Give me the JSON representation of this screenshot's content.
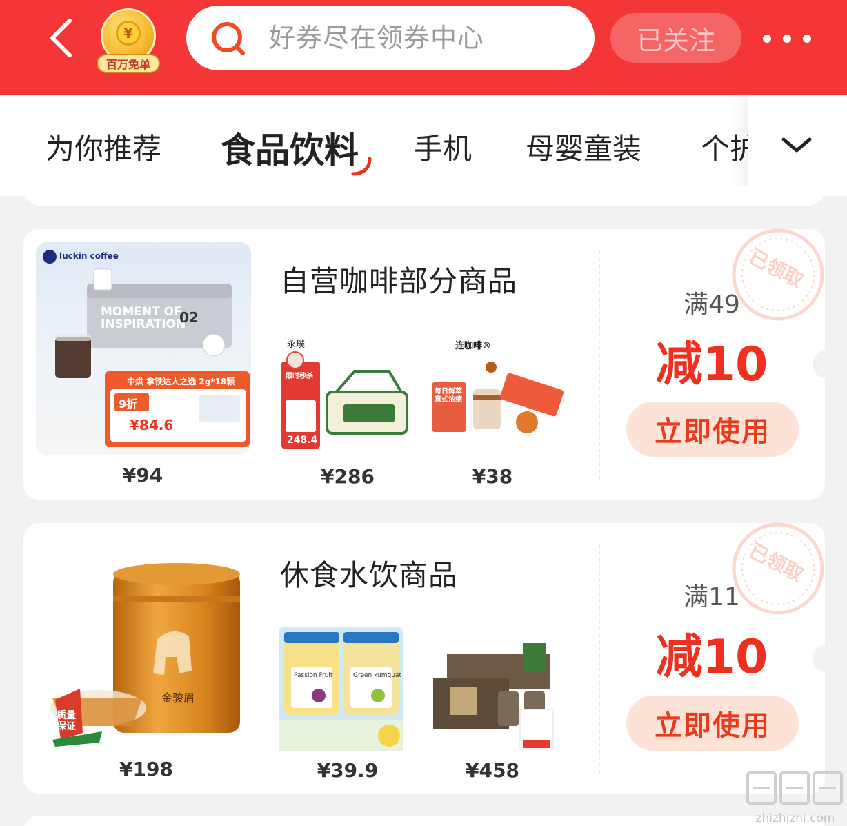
{
  "header": {
    "badge_label": "百万免单",
    "badge_coin_symbol": "¥",
    "search_placeholder": "好券尽在领券中心",
    "follow_label": "已关注"
  },
  "tabs": [
    {
      "label": "为你推荐",
      "active": false
    },
    {
      "label": "食品饮料",
      "active": true
    },
    {
      "label": "手机",
      "active": false
    },
    {
      "label": "母婴童装",
      "active": false
    },
    {
      "label": "个护",
      "active": false
    }
  ],
  "coupons": [
    {
      "title": "自营咖啡部分商品",
      "threshold": "满49",
      "discount": "减10",
      "button": "立即使用",
      "stamp_text": "已领取",
      "main_product": {
        "brand": "luckin coffee",
        "caption_1": "MOMENT OF",
        "caption_2": "INSPIRATION",
        "caption_num": "02",
        "promo_line": "中烘 拿铁达人之选 2g*18颗",
        "promo_discount": "9折",
        "promo_price": "¥84.6",
        "price": "¥94"
      },
      "sub_products": [
        {
          "brand": "永璞",
          "tag": "限时秒杀",
          "promo_price": "248.4",
          "price": "¥286"
        },
        {
          "brand": "连咖啡®",
          "tag": "每日鲜萃 意式浓缩",
          "price": "¥38"
        }
      ]
    },
    {
      "title": "休食水饮商品",
      "threshold": "满11",
      "discount": "减10",
      "button": "立即使用",
      "stamp_text": "已领取",
      "main_product": {
        "name": "金骏眉",
        "seal_1": "质量",
        "seal_2": "保证",
        "price": "¥198"
      },
      "sub_products": [
        {
          "label_1": "Passion Fruit",
          "label_2": "Green kumquat",
          "price": "¥39.9"
        },
        {
          "price": "¥458"
        }
      ]
    }
  ],
  "watermark": {
    "text": "zhizhizhi.com"
  },
  "colors": {
    "header_red": "#f43636",
    "accent_red": "#ef2f1f",
    "button_bg": "#fde3d6",
    "page_bg": "#f2f2f2"
  },
  "icons": [
    "back-arrow-icon",
    "search-icon",
    "more-dots-icon",
    "chevron-down-icon"
  ]
}
